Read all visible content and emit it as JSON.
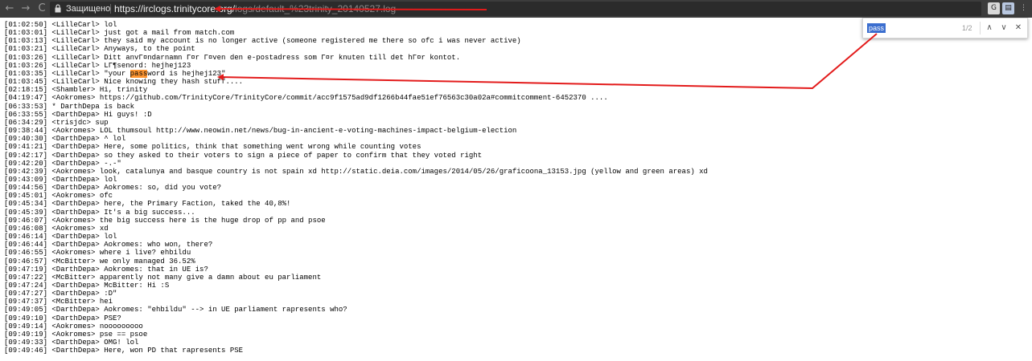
{
  "browser": {
    "back_glyph": "←",
    "forward_glyph": "→",
    "reload_glyph": "C",
    "secure_label": "Защищено",
    "url_host": "https://irclogs.trinitycore.org/",
    "url_path": "logs/default_%23trinity_20140527.log",
    "translate_icon_label": "G",
    "page_icon_label": "▤",
    "menu_glyph": "⋮"
  },
  "find_bar": {
    "query": "pass",
    "count": "1/2",
    "prev_glyph": "∧",
    "next_glyph": "∨",
    "close_glyph": "✕"
  },
  "log": {
    "lines": [
      {
        "before": "[01:02:50] <LilleCarl> lol"
      },
      {
        "before": "[01:03:01] <LilleCarl> just got a mail from match.com"
      },
      {
        "before": "[01:03:13] <LilleCarl> they said my account is no longer active (someone registered me there so ofc i was never active)"
      },
      {
        "before": "[01:03:21] <LilleCarl> Anyways, to the point"
      },
      {
        "before": "[01:03:26] <LilleCarl> Ditt anvГ¤ndarnamn Г¤r Г¤ven den e-postadress som Г¤r knuten till det hГ¤r kontot."
      },
      {
        "before": "[01:03:26] <LilleCarl> LГ¶senord: hejhej123"
      },
      {
        "before": "[01:03:35] <LilleCarl> \"your ",
        "match": "pass",
        "after": "word is hejhej123\""
      },
      {
        "before": "[01:03:45] <LilleCarl> Nice knowing they hash stuff...."
      },
      {
        "before": "[02:18:15] <Shambler> Hi, trinity"
      },
      {
        "before": "[04:19:47] <Aokromes> https://github.com/TrinityCore/TrinityCore/commit/acc9f1575ad9df1266b44fae51ef76563c30a02a#commitcomment-6452370 ...."
      },
      {
        "before": "[06:33:53] * DarthDepa is back"
      },
      {
        "before": "[06:33:55] <DarthDepa> Hi guys! :D"
      },
      {
        "before": "[06:34:29] <trisjdc> sup"
      },
      {
        "before": "[09:38:44] <Aokromes> LOL thumsoul http://www.neowin.net/news/bug-in-ancient-e-voting-machines-impact-belgium-election"
      },
      {
        "before": "[09:40:30] <DarthDepa> ^ lol"
      },
      {
        "before": "[09:41:21] <DarthDepa> Here, some politics, think that something went wrong while counting votes"
      },
      {
        "before": "[09:42:17] <DarthDepa> so they asked to their voters to sign a piece of paper to confirm that they voted right"
      },
      {
        "before": "[09:42:20] <DarthDepa> -.-\""
      },
      {
        "before": "[09:42:39] <Aokromes> look, catalunya and basque country is not spain xd http://static.deia.com/images/2014/05/26/graficoona_13153.jpg (yellow and green areas) xd"
      },
      {
        "before": "[09:43:09] <DarthDepa> lol"
      },
      {
        "before": "[09:44:56] <DarthDepa> Aokromes: so, did you vote?"
      },
      {
        "before": "[09:45:01] <Aokromes> ofc"
      },
      {
        "before": "[09:45:34] <DarthDepa> here, the Primary Faction, taked the 40,8%!"
      },
      {
        "before": "[09:45:39] <DarthDepa> It's a big success..."
      },
      {
        "before": "[09:46:07] <Aokromes> the big success here is the huge drop of pp and psoe"
      },
      {
        "before": "[09:46:08] <Aokromes> xd"
      },
      {
        "before": "[09:46:14] <DarthDepa> lol"
      },
      {
        "before": "[09:46:44] <DarthDepa> Aokromes: who won, there?"
      },
      {
        "before": "[09:46:55] <Aokromes> where i live? ehbildu"
      },
      {
        "before": "[09:46:57] <McBitter> we only managed 36.52%"
      },
      {
        "before": "[09:47:19] <DarthDepa> Aokromes: that in UE is?"
      },
      {
        "before": "[09:47:22] <McBitter> apparently not many give a damn about eu parliament"
      },
      {
        "before": "[09:47:24] <DarthDepa> McBitter: Hi :S"
      },
      {
        "before": "[09:47:27] <DarthDepa> :D\""
      },
      {
        "before": "[09:47:37] <McBitter> hei"
      },
      {
        "before": "[09:49:05] <DarthDepa> Aokromes: \"ehbildu\" --> in UE parliament rapresents who?"
      },
      {
        "before": "[09:49:10] <DarthDepa> PSE?"
      },
      {
        "before": "[09:49:14] <Aokromes> nooooooooo"
      },
      {
        "before": "[09:49:19] <Aokromes> pse == psoe"
      },
      {
        "before": "[09:49:33] <DarthDepa> OMG! lol"
      },
      {
        "before": "[09:49:46] <DarthDepa> Here, won PD that rapresents PSE"
      }
    ]
  },
  "annotation": {
    "color": "#e31b1b"
  }
}
